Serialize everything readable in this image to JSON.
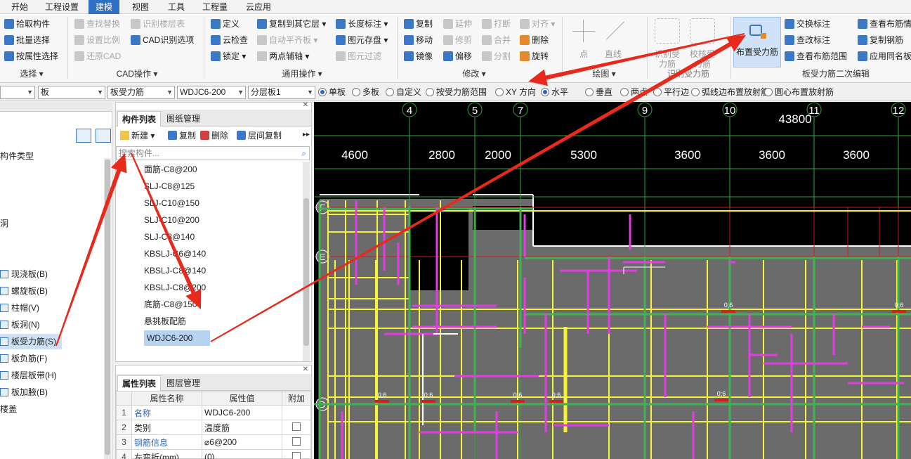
{
  "menu": [
    "开始",
    "工程设置",
    "建模",
    "视图",
    "工具",
    "工程量",
    "云应用"
  ],
  "ribbon": {
    "select": {
      "items": [
        "拾取构件",
        "批量选择",
        "按属性选择"
      ],
      "title": "选择"
    },
    "cad": {
      "items": [
        "查找替换",
        "设置比例",
        "还原CAD",
        "识别楼层表",
        "CAD识别选项"
      ],
      "title": "CAD操作"
    },
    "common": {
      "items": [
        "定义",
        "云检查",
        "锁定",
        "复制到其它层",
        "自动平齐板",
        "两点辅轴",
        "长度标注",
        "图元存盘",
        "图元过滤"
      ],
      "title": "通用操作"
    },
    "modify": {
      "items": [
        "复制",
        "移动",
        "镜像",
        "延伸",
        "修剪",
        "偏移",
        "打断",
        "合并",
        "分割",
        "对齐",
        "删除",
        "旋转"
      ],
      "title": "修改"
    },
    "draw": {
      "items": [
        "点",
        "直线"
      ],
      "title": "绘图"
    },
    "rebar": {
      "items": [
        "识别受力筋",
        "校核受力筋"
      ],
      "title": "识别受力筋"
    },
    "place": {
      "label": "布置受力筋"
    },
    "second": {
      "items": [
        "交换标注",
        "查改标注",
        "查看布筋范围",
        "查看布筋情况",
        "复制钢筋",
        "应用同名板"
      ],
      "title": "板受力筋二次编辑"
    }
  },
  "toolbar2": {
    "combos": [
      "",
      "板",
      "板受力筋",
      "WDJC6-200",
      "分层板1"
    ],
    "radios": [
      {
        "label": "单板",
        "on": true
      },
      {
        "label": "多板",
        "on": false
      },
      {
        "label": "自定义",
        "on": false
      },
      {
        "label": "按受力筋范围",
        "on": false
      },
      {
        "label": "XY 方向",
        "on": false
      },
      {
        "label": "水平",
        "on": true
      },
      {
        "label": "垂直",
        "on": false
      },
      {
        "label": "两点",
        "on": false
      },
      {
        "label": "平行边",
        "on": false
      },
      {
        "label": "弧线边布置放射筋",
        "on": false
      },
      {
        "label": "圆心布置放射筋",
        "on": false
      }
    ]
  },
  "left_nav": {
    "partial_labels": [
      "构件类型",
      "洞"
    ],
    "items": [
      {
        "label": "现浇板(B)",
        "sel": false
      },
      {
        "label": "螺旋板(B)",
        "sel": false
      },
      {
        "label": "柱帽(V)",
        "sel": false
      },
      {
        "label": "板洞(N)",
        "sel": false
      },
      {
        "label": "板受力筋(S)",
        "sel": true
      },
      {
        "label": "板负筋(F)",
        "sel": false
      },
      {
        "label": "楼层板带(H)",
        "sel": false
      },
      {
        "label": "板加腋(B)",
        "sel": false
      }
    ],
    "footer": "楼盖"
  },
  "comp_panel": {
    "tabs": [
      "构件列表",
      "图纸管理"
    ],
    "toolbar": [
      "新建",
      "复制",
      "删除",
      "层间复制"
    ],
    "search_placeholder": "搜索构件...",
    "items": [
      "面筋-C8@200",
      "SLJ-C8@125",
      "SLJ-C10@150",
      "SLJ-C10@200",
      "SLJ-C8@140",
      "KBSLJ-C6@140",
      "KBSLJ-C8@140",
      "KBSLJ-C8@200",
      "底筋-C8@150",
      "悬挑板配筋",
      "WDJC6-200"
    ],
    "selected": 10
  },
  "prop_panel": {
    "tabs": [
      "属性列表",
      "图层管理"
    ],
    "headers": [
      "属性名称",
      "属性值",
      "附加"
    ],
    "rows": [
      {
        "n": "1",
        "name": "名称",
        "value": "WDJC6-200",
        "link": true,
        "chk": false
      },
      {
        "n": "2",
        "name": "类别",
        "value": "温度筋",
        "link": false,
        "chk": true
      },
      {
        "n": "3",
        "name": "钢筋信息",
        "value": "⌀6@200",
        "link": true,
        "chk": true
      },
      {
        "n": "4",
        "name": "左弯折(mm)",
        "value": "(0)",
        "link": false,
        "chk": true
      }
    ]
  },
  "canvas": {
    "axes": [
      {
        "label": "4"
      },
      {
        "label": "5"
      },
      {
        "label": "7"
      },
      {
        "label": "9"
      },
      {
        "label": "10"
      },
      {
        "label": "11"
      },
      {
        "label": "12"
      }
    ],
    "total": "43800",
    "spans": [
      "4600",
      "2800",
      "2000",
      "5300",
      "3600",
      "3600",
      "3600"
    ],
    "row_axes": [
      "F",
      "E",
      "D"
    ],
    "small_labels": [
      "0;6",
      "0;6",
      "0;6",
      "0;6",
      "0;6",
      "0;6",
      "0;6"
    ]
  },
  "colors": {
    "accent": "#2f6fc5",
    "arrow": "#e8291c",
    "canvas_bg": "#000000",
    "plan_fill": "#6b6b6b",
    "rebar_yellow": "#f6f23a",
    "rebar_magenta": "#e23de0",
    "rebar_green": "#3fb34f",
    "axis_green": "#2fa83a",
    "axis_red": "#c81c1c"
  }
}
